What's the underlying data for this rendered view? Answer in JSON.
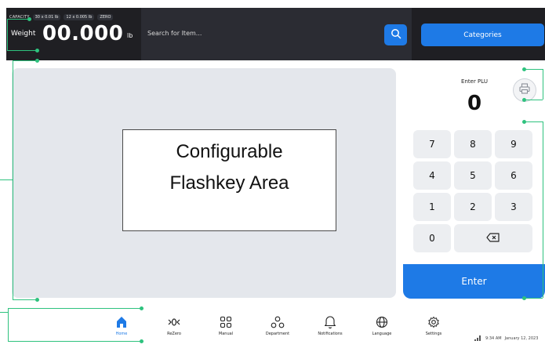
{
  "header": {
    "capacity_label": "CAPACITY",
    "capacity_badges": [
      "30 x 0.01 lb",
      "12 x 0.005 lb",
      "ZERO"
    ],
    "weight_label": "Weight",
    "weight_value": "00.000",
    "weight_unit": "lb",
    "search_placeholder": "Search for Item...",
    "search_icon": "search-icon",
    "categories_label": "Categories"
  },
  "flashkey": {
    "line1": "Configurable",
    "line2": "Flashkey Area"
  },
  "plu": {
    "label": "Enter PLU",
    "value": "0",
    "print_icon": "printer-icon",
    "keys": [
      "7",
      "8",
      "9",
      "4",
      "5",
      "6",
      "1",
      "2",
      "3",
      "0"
    ],
    "backspace_icon": "backspace-icon",
    "enter_label": "Enter"
  },
  "nav": {
    "items": [
      {
        "label": "Home",
        "icon": "home-icon",
        "active": true
      },
      {
        "label": "ReZero",
        "icon": "rezero-icon"
      },
      {
        "label": "Manual",
        "icon": "grid-icon"
      },
      {
        "label": "Department",
        "icon": "department-icon"
      },
      {
        "label": "Notifications",
        "icon": "bell-icon"
      },
      {
        "label": "Language",
        "icon": "globe-icon"
      },
      {
        "label": "Settings",
        "icon": "gear-icon"
      }
    ]
  },
  "status": {
    "signal_icon": "signal-icon",
    "time": "9:34 AM",
    "date": "January 12, 2023"
  },
  "colors": {
    "accent": "#1e7ae6",
    "topbar": "#1f1f23",
    "annotation": "#2ec27e"
  }
}
